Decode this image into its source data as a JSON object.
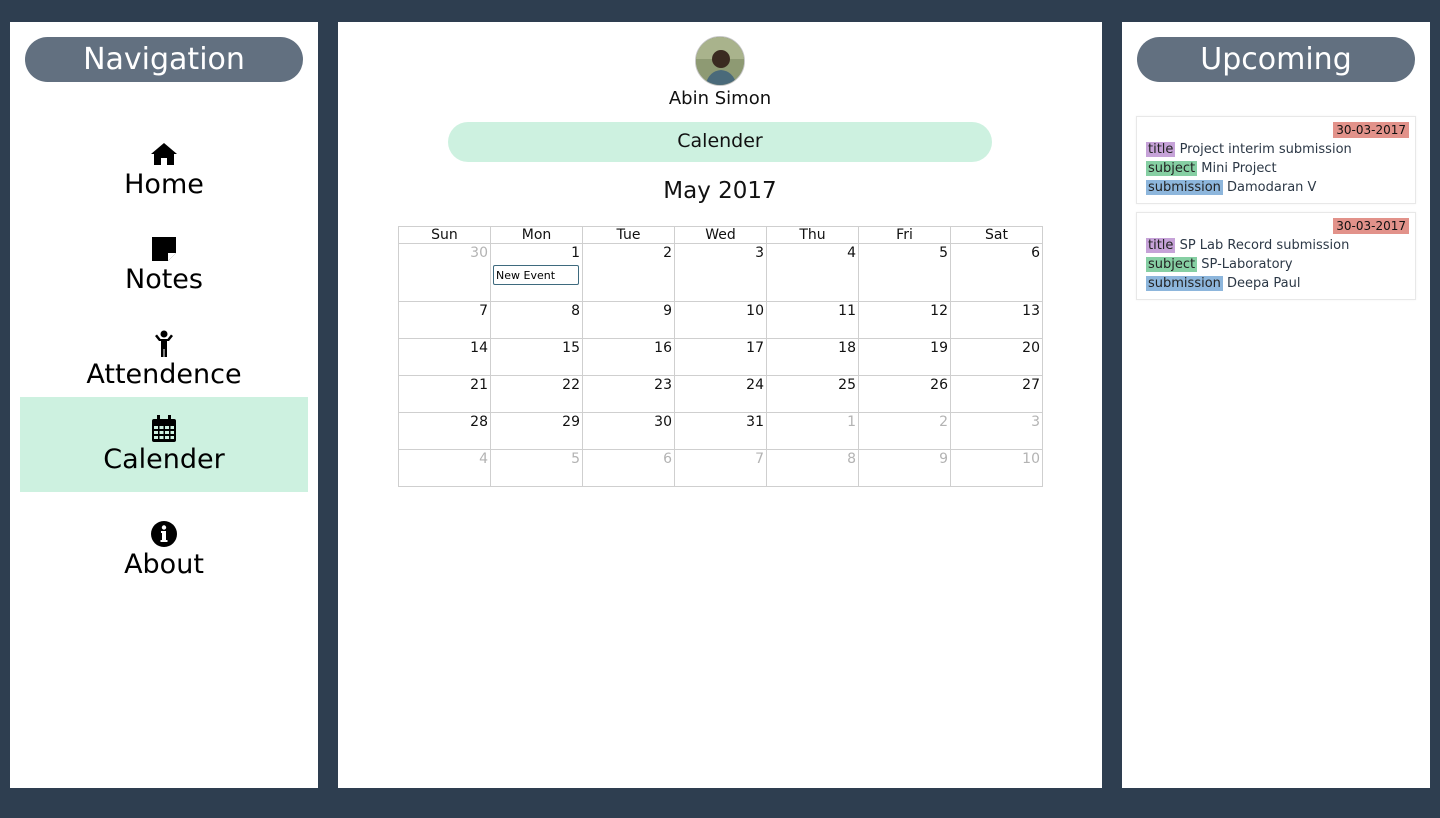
{
  "nav": {
    "title": "Navigation",
    "items": [
      {
        "label": "Home",
        "icon": "home-icon"
      },
      {
        "label": "Notes",
        "icon": "sticky-note-icon"
      },
      {
        "label": "Attendence",
        "icon": "child-icon"
      },
      {
        "label": "Calender",
        "icon": "calendar-icon",
        "active": true
      },
      {
        "label": "About",
        "icon": "info-circle-icon"
      }
    ]
  },
  "main": {
    "user_name": "Abin Simon",
    "page_title": "Calender",
    "month_title": "May 2017",
    "weekdays": [
      "Sun",
      "Mon",
      "Tue",
      "Wed",
      "Thu",
      "Fri",
      "Sat"
    ],
    "weeks": [
      [
        "30",
        "1",
        "2",
        "3",
        "4",
        "5",
        "6"
      ],
      [
        "7",
        "8",
        "9",
        "10",
        "11",
        "12",
        "13"
      ],
      [
        "14",
        "15",
        "16",
        "17",
        "18",
        "19",
        "20"
      ],
      [
        "21",
        "22",
        "23",
        "24",
        "25",
        "26",
        "27"
      ],
      [
        "28",
        "29",
        "30",
        "31",
        "1",
        "2",
        "3"
      ],
      [
        "4",
        "5",
        "6",
        "7",
        "8",
        "9",
        "10"
      ]
    ],
    "new_event_value": "New Event"
  },
  "upcoming": {
    "title": "Upcoming",
    "cards": [
      {
        "date": "30-03-2017",
        "title_tag": "title",
        "title": "Project interim submission",
        "subject_tag": "subject",
        "subject": "Mini Project",
        "submission_tag": "submission",
        "submission": "Damodaran V"
      },
      {
        "date": "30-03-2017",
        "title_tag": "title",
        "title": "SP Lab Record submission",
        "subject_tag": "subject",
        "subject": "SP-Laboratory",
        "submission_tag": "submission",
        "submission": "Deepa Paul"
      }
    ]
  },
  "colors": {
    "background": "#2e3e50",
    "title_pill": "#627080",
    "active_accent": "#cdf1e0",
    "date_badge": "#e2928a",
    "tag_title": "#c6a2d8",
    "tag_subject": "#86cfa3",
    "tag_submission": "#8db6dc"
  }
}
